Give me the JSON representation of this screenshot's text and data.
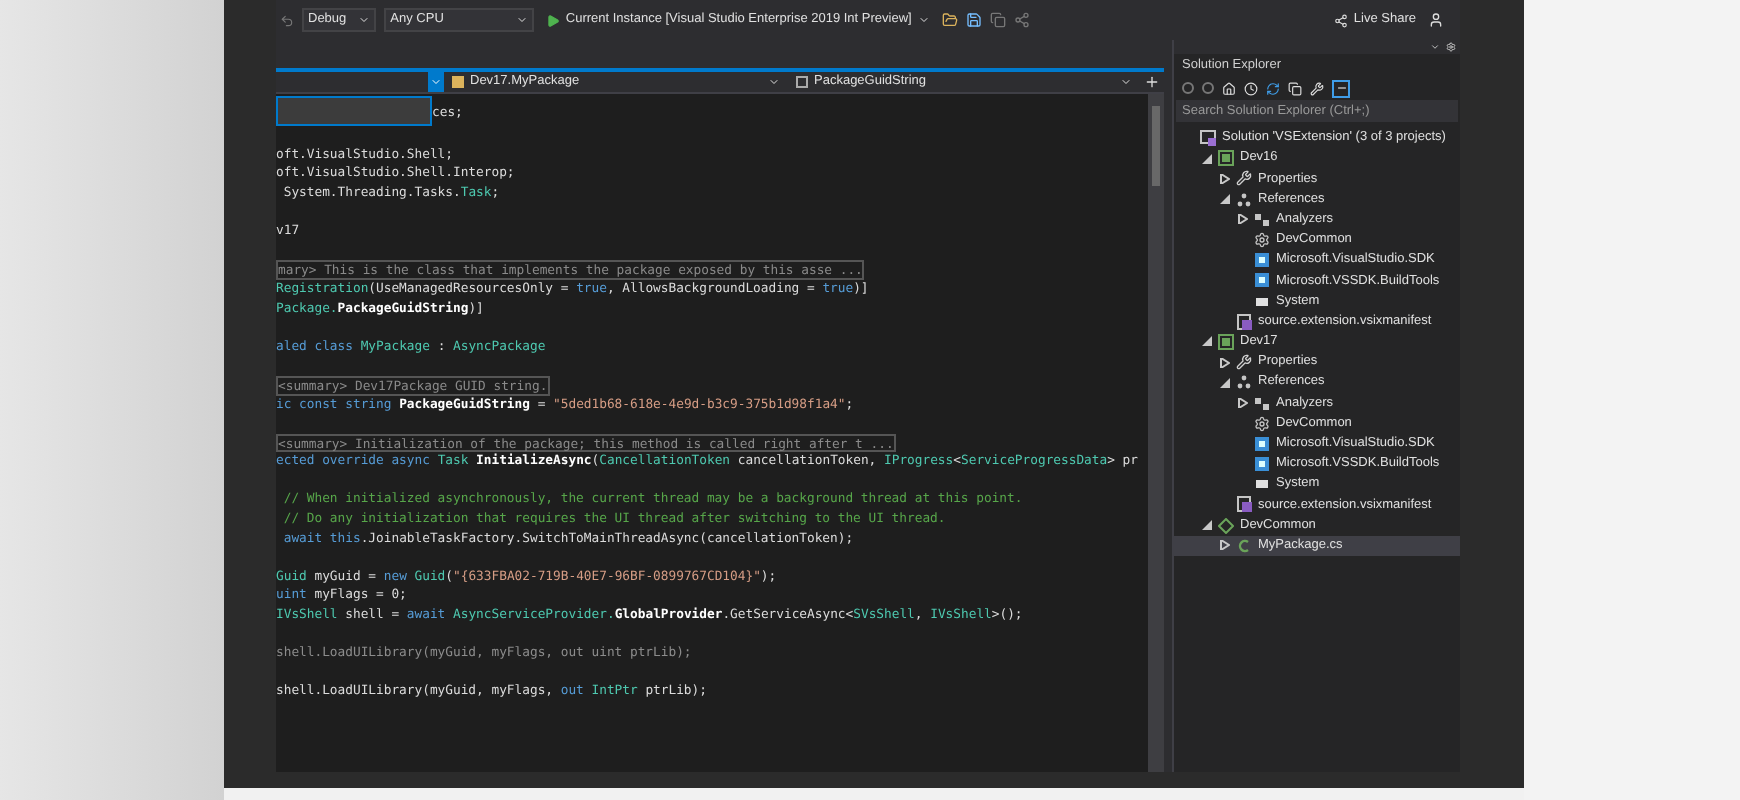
{
  "toolbar": {
    "configuration": "Debug",
    "platform": "Any CPU",
    "run_target": "Current Instance [Visual Studio Enterprise 2019 Int Preview]",
    "live_share": "Live Share"
  },
  "editor": {
    "nav_bar": {
      "type_dropdown": "Dev17.MyPackage",
      "member_dropdown": "PackageGuidString"
    },
    "lines": [
      {
        "kind": "popup_line",
        "tokens": [
          {
            "text": "ces;",
            "kind": "plain"
          }
        ]
      },
      {
        "kind": "blank"
      },
      {
        "kind": "code",
        "tokens": [
          {
            "text": "oft.VisualStudio.Shell;",
            "kind": "plain"
          }
        ]
      },
      {
        "kind": "code",
        "tokens": [
          {
            "text": "oft.VisualStudio.Shell.Interop;",
            "kind": "plain"
          }
        ]
      },
      {
        "kind": "code",
        "tokens": [
          {
            "text": " System.Threading.Tasks.",
            "kind": "plain"
          },
          {
            "text": "Task",
            "kind": "type"
          },
          {
            "text": ";",
            "kind": "plain"
          }
        ]
      },
      {
        "kind": "blank"
      },
      {
        "kind": "code",
        "tokens": [
          {
            "text": "v17",
            "kind": "plain"
          }
        ]
      },
      {
        "kind": "blank"
      },
      {
        "kind": "summary",
        "tokens": [
          {
            "text": "mary> This is the class that implements the package exposed by this asse ...",
            "kind": "comment_doc"
          }
        ]
      },
      {
        "kind": "code",
        "tokens": [
          {
            "text": "Registration",
            "kind": "type"
          },
          {
            "text": "(UseManagedResourcesOnly = ",
            "kind": "plain"
          },
          {
            "text": "true",
            "kind": "keyword"
          },
          {
            "text": ", AllowsBackgroundLoading = ",
            "kind": "plain"
          },
          {
            "text": "true",
            "kind": "keyword"
          },
          {
            "text": ")]",
            "kind": "plain"
          }
        ]
      },
      {
        "kind": "code",
        "tokens": [
          {
            "text": "Package.",
            "kind": "type"
          },
          {
            "text": "PackageGuidString",
            "kind": "bold"
          },
          {
            "text": ")]",
            "kind": "plain"
          }
        ]
      },
      {
        "kind": "blank"
      },
      {
        "kind": "code",
        "tokens": [
          {
            "text": "aled class ",
            "kind": "keyword"
          },
          {
            "text": "MyPackage",
            "kind": "type"
          },
          {
            "text": " : ",
            "kind": "plain"
          },
          {
            "text": "AsyncPackage",
            "kind": "type"
          }
        ]
      },
      {
        "kind": "blank"
      },
      {
        "kind": "summary",
        "tokens": [
          {
            "text": "<summary> Dev17Package GUID string.",
            "kind": "comment_doc"
          }
        ]
      },
      {
        "kind": "code",
        "tokens": [
          {
            "text": "ic const string ",
            "kind": "keyword"
          },
          {
            "text": "PackageGuidString",
            "kind": "bold"
          },
          {
            "text": " = ",
            "kind": "plain"
          },
          {
            "text": "\"5ded1b68-618e-4e9d-b3c9-375b1d98f1a4\"",
            "kind": "string"
          },
          {
            "text": ";",
            "kind": "plain"
          }
        ]
      },
      {
        "kind": "blank"
      },
      {
        "kind": "summary",
        "tokens": [
          {
            "text": "<summary> Initialization of the package; this method is called right after t ...",
            "kind": "comment_doc"
          }
        ]
      },
      {
        "kind": "code",
        "tokens": [
          {
            "text": "ected override async ",
            "kind": "keyword"
          },
          {
            "text": "Task",
            "kind": "type"
          },
          {
            "text": " InitializeAsync",
            "kind": "bold"
          },
          {
            "text": "(",
            "kind": "plain"
          },
          {
            "text": "CancellationToken",
            "kind": "type"
          },
          {
            "text": " cancellationToken, ",
            "kind": "plain"
          },
          {
            "text": "IProgress",
            "kind": "type"
          },
          {
            "text": "<",
            "kind": "plain"
          },
          {
            "text": "ServiceProgressData",
            "kind": "type"
          },
          {
            "text": "> pr",
            "kind": "plain"
          }
        ]
      },
      {
        "kind": "blank"
      },
      {
        "kind": "code",
        "tokens": [
          {
            "text": " // When initialized asynchronously, the current thread may be a background thread at this point.",
            "kind": "comment"
          }
        ]
      },
      {
        "kind": "code",
        "tokens": [
          {
            "text": " // Do any initialization that requires the UI thread after switching to the UI thread.",
            "kind": "comment"
          }
        ]
      },
      {
        "kind": "code",
        "tokens": [
          {
            "text": " await this",
            "kind": "keyword"
          },
          {
            "text": ".JoinableTaskFactory.SwitchToMainThreadAsync(cancellationToken);",
            "kind": "plain"
          }
        ]
      },
      {
        "kind": "blank"
      },
      {
        "kind": "code",
        "tokens": [
          {
            "text": "Guid",
            "kind": "type"
          },
          {
            "text": " myGuid = ",
            "kind": "plain"
          },
          {
            "text": "new ",
            "kind": "keyword"
          },
          {
            "text": "Guid",
            "kind": "type"
          },
          {
            "text": "(",
            "kind": "plain"
          },
          {
            "text": "\"{633FBA02-719B-40E7-96BF-0899767CD104}\"",
            "kind": "string"
          },
          {
            "text": ");",
            "kind": "plain"
          }
        ]
      },
      {
        "kind": "code",
        "tokens": [
          {
            "text": "uint",
            "kind": "keyword"
          },
          {
            "text": " myFlags = 0;",
            "kind": "plain"
          }
        ]
      },
      {
        "kind": "code",
        "tokens": [
          {
            "text": "IVsShell",
            "kind": "type"
          },
          {
            "text": " shell = ",
            "kind": "plain"
          },
          {
            "text": "await ",
            "kind": "keyword"
          },
          {
            "text": "AsyncServiceProvider.",
            "kind": "type"
          },
          {
            "text": "GlobalProvider",
            "kind": "bold"
          },
          {
            "text": ".GetServiceAsync<",
            "kind": "plain"
          },
          {
            "text": "SVsShell",
            "kind": "type"
          },
          {
            "text": ", ",
            "kind": "plain"
          },
          {
            "text": "IVsShell",
            "kind": "type"
          },
          {
            "text": ">();",
            "kind": "plain"
          }
        ]
      },
      {
        "kind": "blank"
      },
      {
        "kind": "code",
        "tokens": [
          {
            "text": "shell.LoadUILibrary(myGuid, myFlags, out uint ptrLib);",
            "kind": "dim"
          }
        ]
      },
      {
        "kind": "blank"
      },
      {
        "kind": "code",
        "tokens": [
          {
            "text": "shell.LoadUILibrary(myGuid, myFlags, ",
            "kind": "plain"
          },
          {
            "text": "out ",
            "kind": "keyword"
          },
          {
            "text": "IntPtr",
            "kind": "type"
          },
          {
            "text": " ptrLib);",
            "kind": "plain"
          }
        ]
      }
    ]
  },
  "solution_explorer": {
    "title": "Solution Explorer",
    "search": {
      "placeholder": "Search Solution Explorer (Ctrl+;)"
    },
    "tree": [
      {
        "label": "Solution 'VSExtension' (3 of 3 projects)",
        "kind": "solution",
        "selected": false,
        "children": [
          {
            "label": "Dev16",
            "kind": "project",
            "expanded": true,
            "selected": false,
            "children": [
              {
                "label": "Properties",
                "kind": "properties",
                "expanded": false,
                "selected": false
              },
              {
                "label": "References",
                "kind": "references",
                "expanded": true,
                "selected": false,
                "children": [
                  {
                    "label": "Analyzers",
                    "kind": "analyzers",
                    "expanded": false,
                    "selected": false
                  },
                  {
                    "label": "DevCommon",
                    "kind": "shared",
                    "selected": false
                  },
                  {
                    "label": "Microsoft.VisualStudio.SDK",
                    "kind": "assembly",
                    "selected": false
                  },
                  {
                    "label": "Microsoft.VSSDK.BuildTools",
                    "kind": "assembly",
                    "selected": false
                  },
                  {
                    "label": "System",
                    "kind": "system",
                    "selected": false
                  }
                ]
              },
              {
                "label": "source.extension.vsixmanifest",
                "kind": "manifest",
                "selected": false
              }
            ]
          },
          {
            "label": "Dev17",
            "kind": "project",
            "expanded": true,
            "selected": false,
            "children": [
              {
                "label": "Properties",
                "kind": "properties",
                "expanded": false,
                "selected": false
              },
              {
                "label": "References",
                "kind": "references",
                "expanded": true,
                "selected": false,
                "children": [
                  {
                    "label": "Analyzers",
                    "kind": "analyzers",
                    "expanded": false,
                    "selected": false
                  },
                  {
                    "label": "DevCommon",
                    "kind": "shared",
                    "selected": false
                  },
                  {
                    "label": "Microsoft.VisualStudio.SDK",
                    "kind": "assembly",
                    "selected": false
                  },
                  {
                    "label": "Microsoft.VSSDK.BuildTools",
                    "kind": "assembly",
                    "selected": false
                  },
                  {
                    "label": "System",
                    "kind": "system",
                    "selected": false
                  }
                ]
              },
              {
                "label": "source.extension.vsixmanifest",
                "kind": "manifest",
                "selected": false
              }
            ]
          },
          {
            "label": "DevCommon",
            "kind": "shared_project",
            "expanded": true,
            "selected": false,
            "children": [
              {
                "label": "MyPackage.cs",
                "kind": "csfile",
                "expanded": false,
                "selected": true
              }
            ]
          }
        ]
      }
    ]
  }
}
